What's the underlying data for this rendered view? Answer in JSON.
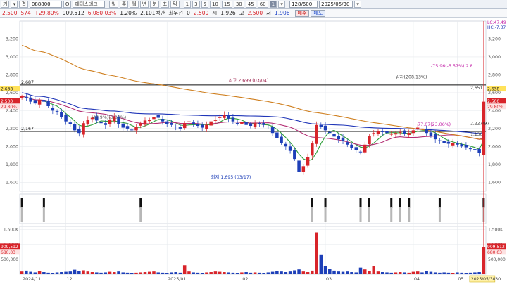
{
  "toolbar": {
    "menu_glyph": "기",
    "down_glyph": "▾",
    "exchange": "겹",
    "code": "088800",
    "search_glyph": "Q",
    "stock_name": "에이스테크",
    "period_buttons": [
      "일",
      "주",
      "월",
      "년",
      "분",
      "초",
      "틱"
    ],
    "interval_buttons": [
      "1",
      "3",
      "5",
      "10",
      "15",
      "30",
      "45",
      "60",
      "1"
    ],
    "step_glyph": "▾",
    "count": "128/600",
    "date": "2025/05/30",
    "calendar_glyph": "▾"
  },
  "quote": {
    "price": "2,500",
    "change": "574",
    "change_pct": "+29.80%",
    "volume": "909,512",
    "volume_ratio": "6,080.03%",
    "rate": "1.20%",
    "trade_value": "2,101백만",
    "label_min_price": "최우선",
    "min_value": "0",
    "open": "2,500",
    "label_high": "시",
    "high": "1,926",
    "label_low": "고",
    "low": "2,500",
    "label_close": "저",
    "close": "1,906",
    "buy_label": "매수",
    "sell_label": "매도"
  },
  "chart_data": {
    "type": "candlestick",
    "price_axis": {
      "ticks": [
        "3,200",
        "3,000",
        "2,800",
        "2,600",
        "2,400",
        "2,200",
        "2,000",
        "1,800",
        "1,600"
      ],
      "ylim": [
        1500,
        3400
      ]
    },
    "volume_axis": {
      "ticks": [
        "1,500K",
        "1,000K",
        "500,000"
      ],
      "ylim": [
        0,
        1600000
      ]
    },
    "x_ticks": [
      "2024/11",
      "12",
      "2025/01",
      "02",
      "03",
      "04",
      "05"
    ],
    "x_end_label": "2025/05/30",
    "x_end_tick": "05/30",
    "closes": [
      2560,
      2540,
      2500,
      2480,
      2520,
      2500,
      2450,
      2400,
      2380,
      2330,
      2280,
      2250,
      2180,
      2150,
      2260,
      2300,
      2320,
      2290,
      2260,
      2240,
      2300,
      2330,
      2250,
      2210,
      2200,
      2180,
      2220,
      2260,
      2290,
      2300,
      2330,
      2320,
      2280,
      2250,
      2240,
      2220,
      2200,
      2260,
      2280,
      2250,
      2230,
      2210,
      2240,
      2280,
      2300,
      2330,
      2350,
      2310,
      2280,
      2260,
      2270,
      2240,
      2230,
      2260,
      2250,
      2240,
      2220,
      2150,
      2090,
      2040,
      2000,
      1950,
      1860,
      1720,
      1780,
      1880,
      2040,
      2240,
      2220,
      2180,
      2150,
      2110,
      2080,
      2060,
      2020,
      1980,
      1960,
      1940,
      2020,
      2120,
      2150,
      2170,
      2160,
      2150,
      2140,
      2150,
      2160,
      2140,
      2150,
      2180,
      2210,
      2200,
      2150,
      2120,
      2080,
      2060,
      2040,
      2030,
      2040,
      2020,
      2000,
      1990,
      1970,
      1960,
      1926,
      2500
    ],
    "series": [
      {
        "name": "MA5",
        "color": "#2e9e3a"
      },
      {
        "name": "MA20",
        "color": "#b32e74"
      },
      {
        "name": "MA60",
        "color": "#2036b8"
      },
      {
        "name": "MA120",
        "color": "#cf7f1f"
      }
    ],
    "horizontal_lines": [
      {
        "label": "2,687",
        "value": 2687
      },
      {
        "label": "2,167",
        "value": 2167
      }
    ],
    "annotations": {
      "high": "최고 2,699 (03/04)",
      "low": "최저 1,695 (03/17)",
      "mid": "-(7.9%)(0.00%)",
      "drop": "감자(208.13%)",
      "pct1": "-75.96(-5.57%) 2.8",
      "pct2": "77.07(23.06%)",
      "box1": "1,130",
      "box2": "2,227(97",
      "box3": "2,651"
    },
    "right_labels": {
      "lc": "LC:47.49",
      "hc": "HC:-7.37",
      "price_tag": "2,638",
      "price_tag2": "2,500",
      "pct_tag": "29.80%",
      "vol_tag": "909,512",
      "vol_tag2": "680,03"
    },
    "left_labels": {
      "price": "2,638",
      "price2": "2,500",
      "pct": "29.80%",
      "vol": "909,512",
      "vol2": "680,03"
    },
    "volumes": [
      90000,
      120000,
      80000,
      60000,
      100000,
      70000,
      50000,
      40000,
      60000,
      70000,
      80000,
      90000,
      150000,
      110000,
      130000,
      90000,
      70000,
      60000,
      50000,
      60000,
      80000,
      70000,
      90000,
      60000,
      50000,
      40000,
      50000,
      60000,
      70000,
      80000,
      90000,
      60000,
      50000,
      40000,
      60000,
      70000,
      50000,
      300000,
      90000,
      60000,
      50000,
      40000,
      60000,
      70000,
      90000,
      80000,
      70000,
      60000,
      50000,
      40000,
      60000,
      70000,
      50000,
      60000,
      50000,
      40000,
      60000,
      80000,
      110000,
      90000,
      70000,
      90000,
      130000,
      160000,
      90000,
      70000,
      120000,
      1400000,
      640000,
      260000,
      180000,
      120000,
      90000,
      80000,
      90000,
      70000,
      60000,
      220000,
      160000,
      110000,
      260000,
      90000,
      70000,
      60000,
      50000,
      60000,
      70000,
      60000,
      50000,
      80000,
      90000,
      60000,
      110000,
      80000,
      60000,
      50000,
      60000,
      50000,
      40000,
      60000,
      50000,
      40000,
      50000,
      60000,
      70000,
      909512
    ],
    "signal_bars": [
      3,
      0,
      0,
      0,
      8,
      0,
      0,
      0,
      0,
      0,
      0,
      0,
      0,
      0,
      0,
      0,
      0,
      0,
      0,
      0,
      0,
      0,
      0,
      0,
      0,
      0,
      0,
      0,
      0,
      0,
      0,
      0,
      0,
      0,
      0,
      0,
      0,
      0,
      0,
      0,
      0,
      0,
      0,
      0,
      0,
      0,
      0,
      0,
      0,
      0,
      0,
      0,
      0,
      0,
      0,
      0,
      0,
      0,
      0,
      0,
      0,
      0,
      0,
      0,
      0,
      0,
      0,
      0,
      0,
      0,
      0,
      0,
      0,
      0,
      0,
      0,
      0,
      0,
      0,
      0,
      0,
      0,
      0,
      0,
      0,
      0,
      0,
      0,
      0,
      0,
      0,
      0,
      0,
      0,
      0,
      0,
      0,
      0,
      0,
      0,
      0,
      0,
      0,
      0,
      0,
      0
    ]
  },
  "colors": {
    "up": "#d8242a",
    "down": "#1d3fb8",
    "grid": "#e6e9ee"
  }
}
